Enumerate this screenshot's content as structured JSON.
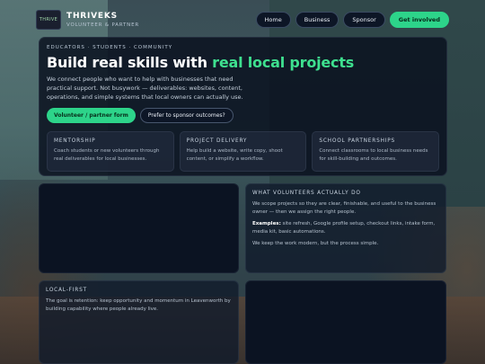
{
  "brand": {
    "logo_text": "THRIVE",
    "name": "THRIVEKS",
    "tagline": "VOLUNTEER & PARTNER"
  },
  "nav": {
    "items": [
      {
        "label": "Home"
      },
      {
        "label": "Business"
      },
      {
        "label": "Sponsor"
      }
    ],
    "cta_label": "Get involved"
  },
  "hero": {
    "eyebrow": "EDUCATORS · STUDENTS · COMMUNITY",
    "title_main": "Build real skills with ",
    "title_accent": "real local projects",
    "description": "We connect people who want to help with businesses that need practical support. Not busywork — deliverables: websites, content, operations, and simple systems that local owners can actually use.",
    "primary_button": "Volunteer / partner form",
    "secondary_button": "Prefer to sponsor outcomes?",
    "cards": [
      {
        "title": "MENTORSHIP",
        "text": "Coach students or new volunteers through real deliverables for local businesses."
      },
      {
        "title": "PROJECT DELIVERY",
        "text": "Help build a website, write copy, shoot content, or simplify a workflow."
      },
      {
        "title": "SCHOOL PARTNERSHIPS",
        "text": "Connect classrooms to local business needs for skill-building and outcomes."
      }
    ]
  },
  "volunteers": {
    "title": "WHAT VOLUNTEERS ACTUALLY DO",
    "text1": "We scope projects so they are clear, finishable, and useful to the business owner — then we assign the right people.",
    "examples_label": "Examples:",
    "examples_text": " site refresh, Google profile setup, checkout links, intake form, media kit, basic automations.",
    "text3": "We keep the work modern, but the process simple."
  },
  "local_first": {
    "title": "LOCAL-FIRST",
    "text": "The goal is retention: keep opportunity and momentum in Leavenworth by building capability where people already live."
  },
  "colors": {
    "accent": "#2dd48a",
    "panel": "#0a1220",
    "title_accent": "#3ee08f"
  }
}
